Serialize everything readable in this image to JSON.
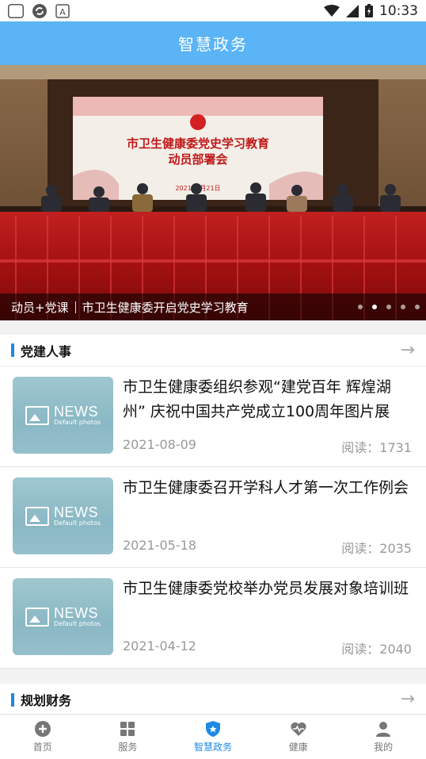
{
  "status_bar": {
    "time": "10:33"
  },
  "app_bar": {
    "title": "智慧政务"
  },
  "banner": {
    "screen_line1": "市卫生健康委党史学习教育",
    "screen_line2": "动员部署会",
    "screen_date": "2021年 月21日",
    "caption_tag": "动员+党课",
    "caption_text": "市卫生健康委开启党史学习教育",
    "slides": 5,
    "active_slide": 2
  },
  "section1": {
    "title": "党建人事",
    "items": [
      {
        "title": "市卫生健康委组织参观“建党百年 辉煌湖州” 庆祝中国共产党成立100周年图片展",
        "date": "2021-08-09",
        "reads": "阅读：1731"
      },
      {
        "title": "市卫生健康委召开学科人才第一次工作例会",
        "date": "2021-05-18",
        "reads": "阅读：2035"
      },
      {
        "title": "市卫生健康委党校举办党员发展对象培训班",
        "date": "2021-04-12",
        "reads": "阅读：2040"
      }
    ]
  },
  "section2": {
    "title": "规划财务"
  },
  "thumb": {
    "news": "NEWS",
    "sub": "Default photos"
  },
  "tabs": [
    {
      "label": "首页",
      "icon": "home-icon"
    },
    {
      "label": "服务",
      "icon": "grid-icon"
    },
    {
      "label": "智慧政务",
      "icon": "shield-icon",
      "active": true
    },
    {
      "label": "健康",
      "icon": "heart-icon"
    },
    {
      "label": "我的",
      "icon": "user-icon"
    }
  ],
  "colors": {
    "accent": "#1e88e5",
    "appbar": "#5ab4f5"
  }
}
